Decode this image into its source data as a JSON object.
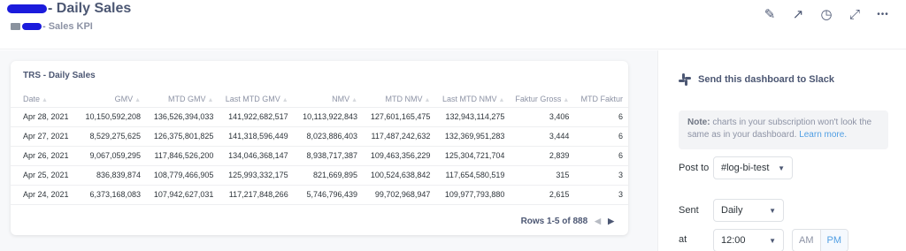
{
  "header": {
    "title": "- Daily Sales",
    "collection": "- Sales KPI"
  },
  "actions": [
    {
      "name": "edit-icon",
      "glyph": "✎"
    },
    {
      "name": "fullscreen-arrow-icon",
      "glyph": "↗"
    },
    {
      "name": "clock-icon",
      "glyph": "◷"
    },
    {
      "name": "expand-icon",
      "glyph": "⤢"
    },
    {
      "name": "more-icon",
      "glyph": "•••"
    }
  ],
  "card": {
    "title": "TRS - Daily Sales",
    "columns": [
      "Date",
      "GMV",
      "MTD GMV",
      "Last MTD GMV",
      "NMV",
      "MTD NMV",
      "Last MTD NMV",
      "Faktur Gross",
      "MTD Faktur"
    ],
    "rows": [
      [
        "Apr 28, 2021",
        "10,150,592,208",
        "136,526,394,033",
        "141,922,682,517",
        "10,113,922,843",
        "127,601,165,475",
        "132,943,114,275",
        "3,406",
        "6"
      ],
      [
        "Apr 27, 2021",
        "8,529,275,625",
        "126,375,801,825",
        "141,318,596,449",
        "8,023,886,403",
        "117,487,242,632",
        "132,369,951,283",
        "3,444",
        "6"
      ],
      [
        "Apr 26, 2021",
        "9,067,059,295",
        "117,846,526,200",
        "134,046,368,147",
        "8,938,717,387",
        "109,463,356,229",
        "125,304,721,704",
        "2,839",
        "6"
      ],
      [
        "Apr 25, 2021",
        "836,839,874",
        "108,779,466,905",
        "125,993,332,175",
        "821,669,895",
        "100,524,638,842",
        "117,654,580,519",
        "315",
        "3"
      ],
      [
        "Apr 24, 2021",
        "6,373,168,083",
        "107,942,627,031",
        "117,217,848,266",
        "5,746,796,439",
        "99,702,968,947",
        "109,977,793,880",
        "2,615",
        "3"
      ]
    ],
    "pagination": "Rows 1-5 of 888"
  },
  "side": {
    "slack_label": "Send this dashboard to Slack",
    "note_bold": "Note:",
    "note_text": " charts in your subscription won't look the same as in your dashboard. ",
    "note_link": "Learn more.",
    "post_to_label": "Post to",
    "channel": "#log-bi-test",
    "sent_label": "Sent",
    "frequency": "Daily",
    "at_label": "at",
    "time": "12:00",
    "am": "AM",
    "pm": "PM"
  },
  "colors": {
    "accent": "#509ee3",
    "text": "#4c5773",
    "redaction": "#1b1bdc"
  }
}
